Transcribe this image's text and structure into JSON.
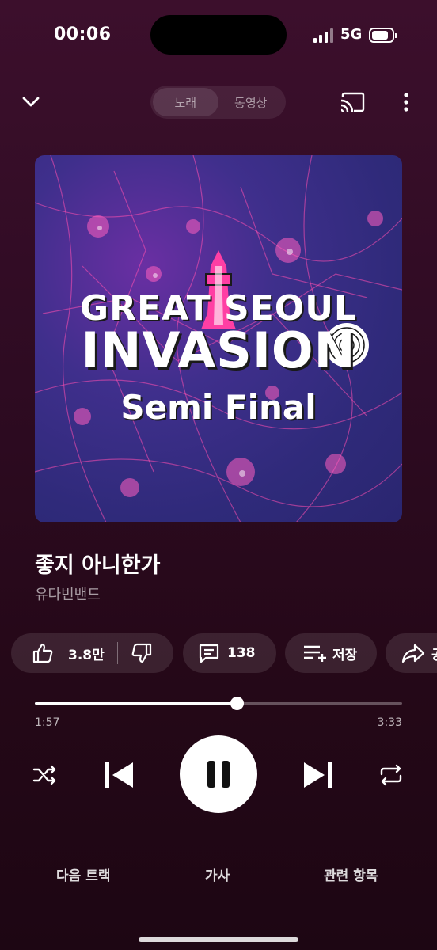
{
  "status_bar": {
    "time": "00:06",
    "network": "5G",
    "battery_level": 0.85
  },
  "header": {
    "tabs": [
      {
        "label": "노래",
        "active": true
      },
      {
        "label": "동영상",
        "active": false
      }
    ],
    "icons": [
      "chevron-down-icon",
      "cast-icon",
      "more-vert-icon"
    ]
  },
  "album_art": {
    "line1": "GREAT   SEOUL",
    "line2": "INVASION",
    "line3": "Semi Final"
  },
  "track": {
    "title": "좋지 아니한가",
    "artist": "유다빈밴드"
  },
  "actions": {
    "like_count": "3.8만",
    "comment_count": "138",
    "save_label": "저장",
    "share_label": "공"
  },
  "progress": {
    "current": "1:57",
    "total": "3:33",
    "fraction": 0.549
  },
  "controls": [
    "shuffle-icon",
    "previous-icon",
    "pause-icon",
    "next-icon",
    "repeat-icon"
  ],
  "bottom_tabs": [
    "다음 트랙",
    "가사",
    "관련 항목"
  ],
  "colors": {
    "background_top": "#3c0f2c",
    "background_bottom": "#1d0613",
    "accent": "#ff3fa4"
  }
}
